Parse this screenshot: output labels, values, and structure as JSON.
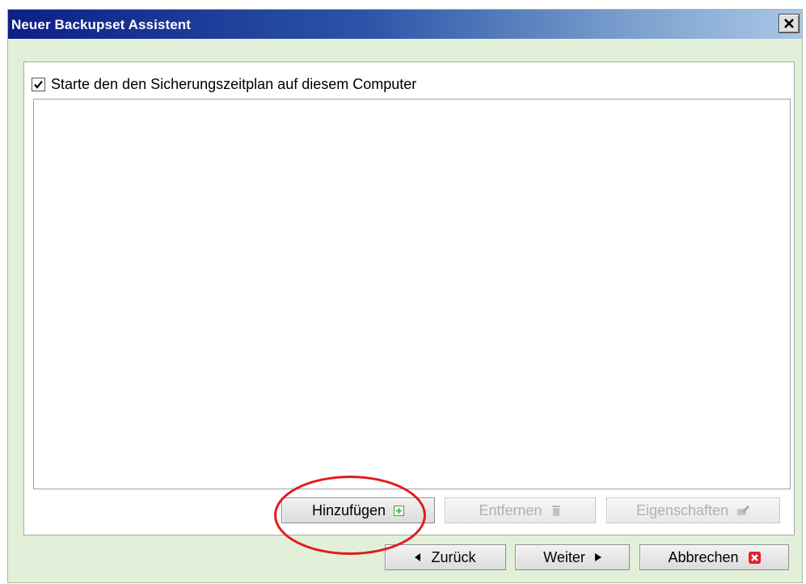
{
  "window": {
    "title": "Neuer Backupset Assistent",
    "close_label": "×"
  },
  "schedule": {
    "checkbox_label": "Starte den den Sicherungszeitplan auf diesem Computer",
    "checked": true,
    "items": []
  },
  "list_buttons": {
    "add": {
      "label": "Hinzufügen",
      "icon": "add-icon",
      "enabled": true
    },
    "remove": {
      "label": "Entfernen",
      "icon": "trash-icon",
      "enabled": false
    },
    "properties": {
      "label": "Eigenschaften",
      "icon": "edit-icon",
      "enabled": false
    }
  },
  "nav_buttons": {
    "back": {
      "label": "Zurück",
      "icon": "arrow-left-icon"
    },
    "next": {
      "label": "Weiter",
      "icon": "arrow-right-icon"
    },
    "cancel": {
      "label": "Abbrechen",
      "icon": "cancel-icon"
    }
  },
  "colors": {
    "window_bg": "#e3f0d9",
    "title_start": "#0d1f87",
    "title_end": "#a9c6e6",
    "annotation": "#e11b1b",
    "cancel_icon": "#e0202a",
    "add_icon": "#3aa63a"
  }
}
